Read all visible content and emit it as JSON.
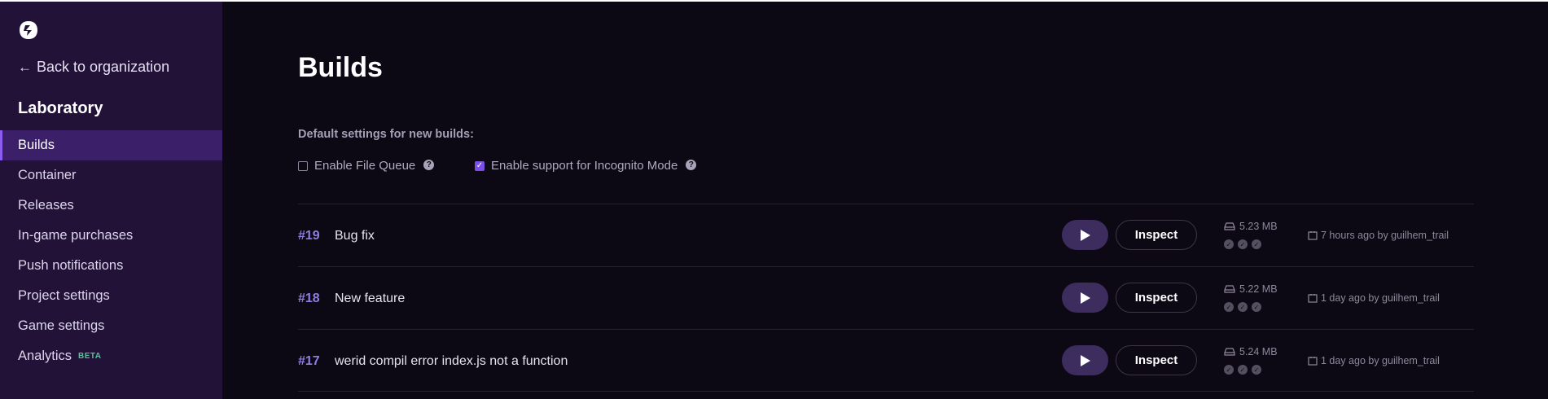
{
  "sidebar": {
    "back_label": "Back to organization",
    "project_name": "Laboratory",
    "items": [
      {
        "label": "Builds"
      },
      {
        "label": "Container"
      },
      {
        "label": "Releases"
      },
      {
        "label": "In-game purchases"
      },
      {
        "label": "Push notifications"
      },
      {
        "label": "Project settings"
      },
      {
        "label": "Game settings"
      },
      {
        "label": "Analytics",
        "badge": "BETA"
      }
    ],
    "active_index": 0
  },
  "main": {
    "title": "Builds",
    "settings_label": "Default settings for new builds:",
    "options": [
      {
        "label": "Enable File Queue",
        "checked": false
      },
      {
        "label": "Enable support for Incognito Mode",
        "checked": true
      }
    ],
    "builds": [
      {
        "number": "#19",
        "name": "Bug fix",
        "size": "5.23 MB",
        "meta": "7 hours ago by guilhem_trail",
        "inspect_label": "Inspect"
      },
      {
        "number": "#18",
        "name": "New feature",
        "size": "5.22 MB",
        "meta": "1 day ago by guilhem_trail",
        "inspect_label": "Inspect"
      },
      {
        "number": "#17",
        "name": "werid compil error index.js not a function",
        "size": "5.24 MB",
        "meta": "1 day ago by guilhem_trail",
        "inspect_label": "Inspect"
      }
    ]
  },
  "colors": {
    "sidebar_bg": "#221238",
    "active_item": "#3b1f68",
    "accent": "#7c4ee8",
    "build_number": "#8f7fe0",
    "beta_badge": "#4ec995",
    "main_bg": "#0c0914"
  },
  "icons": [
    "logo-icon",
    "arrow-left-icon",
    "help-icon",
    "play-icon",
    "drive-icon",
    "check-circle-icon",
    "calendar-icon"
  ]
}
